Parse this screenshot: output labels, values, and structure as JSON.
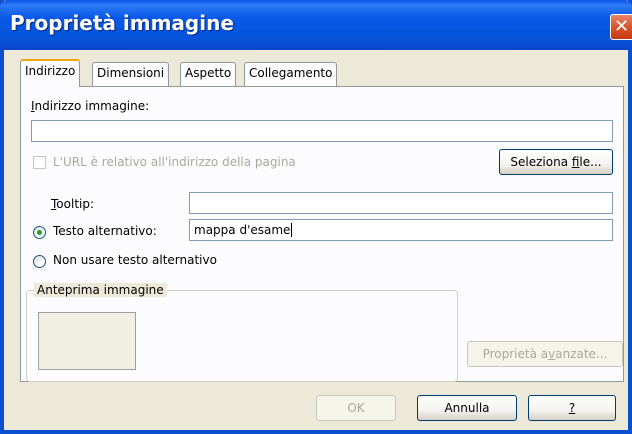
{
  "window": {
    "title": "Proprietà immagine",
    "close_glyph": "✕"
  },
  "tabs": [
    {
      "label": "Indirizzo",
      "active": true
    },
    {
      "label": "Dimensioni",
      "active": false
    },
    {
      "label": "Aspetto",
      "active": false
    },
    {
      "label": "Collegamento",
      "active": false
    }
  ],
  "address": {
    "label_first": "I",
    "label_rest": "ndirizzo immagine:",
    "value": ""
  },
  "relative_url": {
    "label": "L'URL è relativo all'indirizzo della pagina",
    "checked": false,
    "enabled": false
  },
  "choose_file": {
    "label_pre": "Seleziona ",
    "label_u": "f",
    "label_post": "ile..."
  },
  "tooltip": {
    "label_first": "T",
    "label_rest": "ooltip:",
    "value": ""
  },
  "alt_text": {
    "label": "Testo alternativo:",
    "value": "mappa d'esame",
    "selected": true
  },
  "no_alt_text": {
    "label": "Non usare testo alternativo",
    "selected": false
  },
  "preview": {
    "title": "Anteprima immagine"
  },
  "advanced": {
    "label_pre": "Proprietà a",
    "label_u": "v",
    "label_post": "anzate..."
  },
  "footer": {
    "ok_label": "OK",
    "cancel_label": "Annulla",
    "help_label": "?"
  },
  "colors": {
    "titlebar": "#0a58e8",
    "dialog_bg": "#ece9d8",
    "close_button": "#d9542e",
    "radio_dot": "#21a121",
    "tab_highlight": "#f5a30c"
  },
  "icons": {
    "close": "close-icon"
  }
}
